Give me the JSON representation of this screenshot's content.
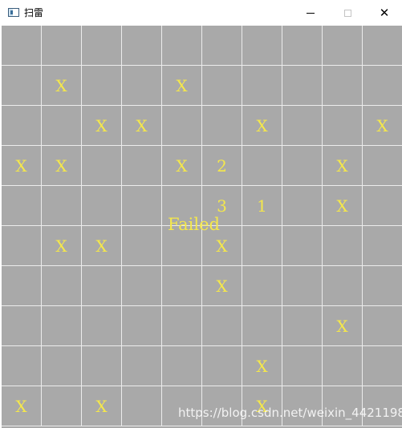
{
  "window": {
    "title": "扫雷",
    "icon": "app-window-icon",
    "controls": {
      "minimize": "minimize-icon",
      "maximize": "maximize-icon",
      "close": "close-icon",
      "close_glyph": "✕"
    }
  },
  "game": {
    "status_text": "Failed",
    "rows": 10,
    "cols": 10,
    "grid": [
      [
        "",
        "",
        "",
        "",
        "",
        "",
        "",
        "",
        "",
        ""
      ],
      [
        "",
        "X",
        "",
        "",
        "X",
        "",
        "",
        "",
        "",
        ""
      ],
      [
        "",
        "",
        "X",
        "X",
        "",
        "",
        "X",
        "",
        "",
        "X"
      ],
      [
        "X",
        "X",
        "",
        "",
        "X",
        "2",
        "",
        "",
        "X",
        ""
      ],
      [
        "",
        "",
        "",
        "",
        "",
        "3",
        "1",
        "",
        "X",
        ""
      ],
      [
        "",
        "X",
        "X",
        "",
        "",
        "X",
        "",
        "",
        "",
        ""
      ],
      [
        "",
        "",
        "",
        "",
        "",
        "X",
        "",
        "",
        "",
        ""
      ],
      [
        "",
        "",
        "",
        "",
        "",
        "",
        "",
        "",
        "X",
        ""
      ],
      [
        "",
        "",
        "",
        "",
        "",
        "",
        "X",
        "",
        "",
        ""
      ],
      [
        "X",
        "",
        "X",
        "",
        "",
        "",
        "X",
        "",
        "",
        ""
      ]
    ],
    "colors": {
      "cell_bg": "#a9a9a9",
      "grid_line": "#ececec",
      "text": "#f5e84a"
    }
  },
  "watermark": "https://blog.csdn.net/weixin_44211980"
}
